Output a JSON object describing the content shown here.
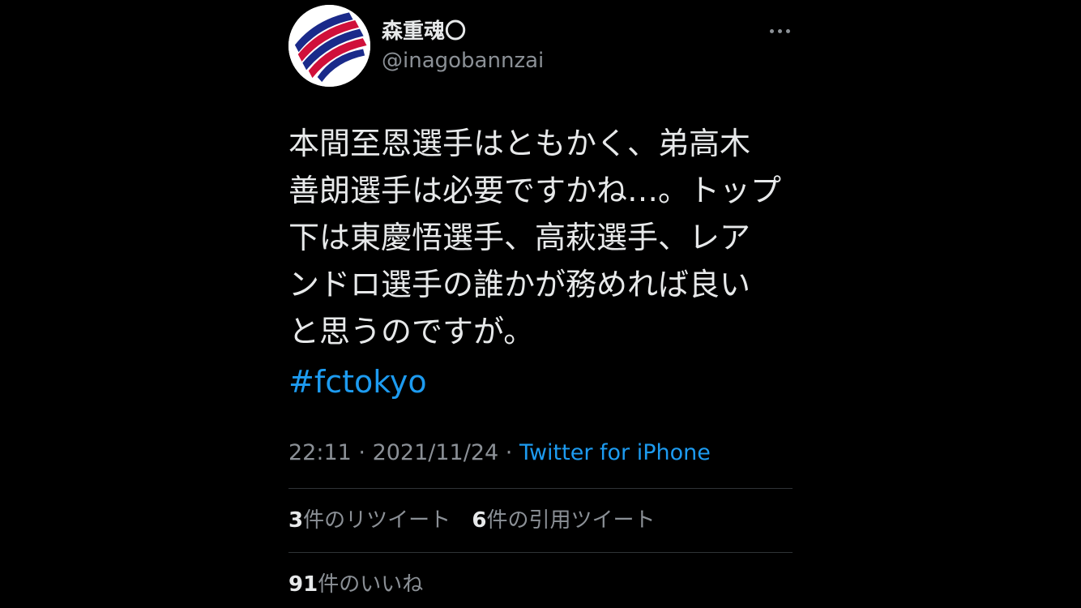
{
  "author": {
    "display_name": "森重魂〇",
    "handle": "@inagobannzai",
    "avatar_colors": [
      "#1a2a8a",
      "#d0103a"
    ]
  },
  "more_icon": "more-horizontal-icon",
  "tweet": {
    "lines": [
      "本間至恩選手はともかく、弟高木",
      "善朗選手は必要ですかね…。トップ",
      "下は東慶悟選手、高萩選手、レア",
      "ンドロ選手の誰かが務めれば良い",
      "と思うのですが。"
    ],
    "hashtag": "#fctokyo"
  },
  "meta": {
    "time": "22:11",
    "sep1": " · ",
    "date": "2021/11/24",
    "sep2": " · ",
    "source": "Twitter for iPhone"
  },
  "stats": {
    "retweets_count": "3",
    "retweets_label": "件のリツイート",
    "quotes_count": "6",
    "quotes_label": "件の引用ツイート",
    "likes_count": "91",
    "likes_label": "件のいいね"
  },
  "colors": {
    "background": "#000000",
    "text": "#e7e9ea",
    "secondary": "#8b9096",
    "link": "#1d9bf0",
    "divider": "#2f3336"
  }
}
